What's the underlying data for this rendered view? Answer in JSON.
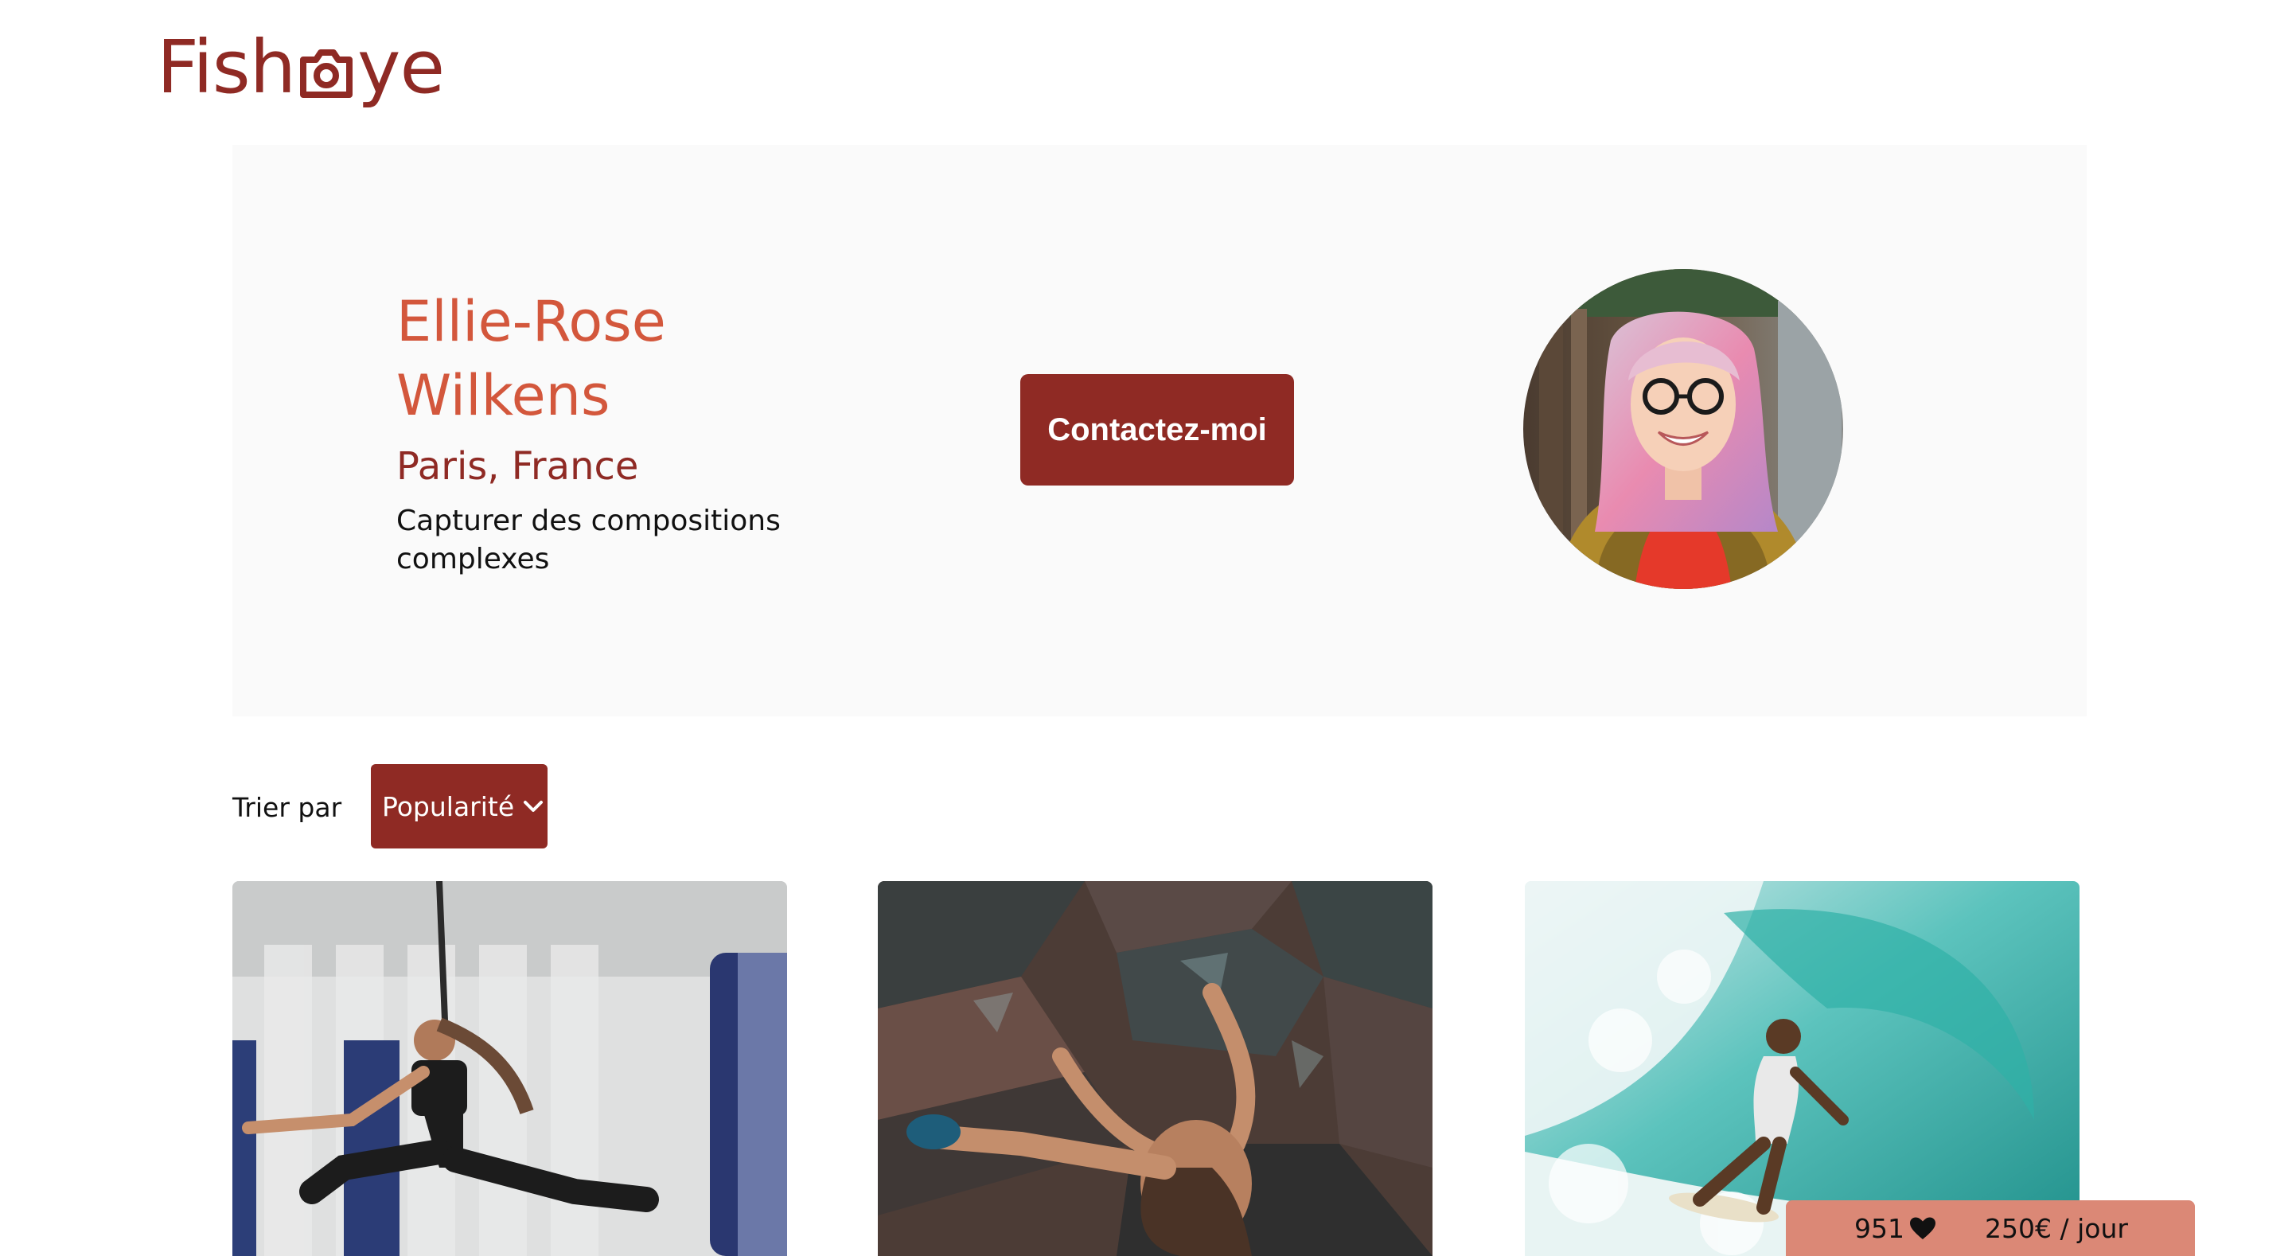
{
  "logo": {
    "text_left": "Fish",
    "text_right": "ye",
    "icon": "camera-icon",
    "color": "#8f2a24"
  },
  "photographer": {
    "name": "Ellie-Rose Wilkens",
    "location": "Paris, France",
    "tagline": "Capturer des compositions complexes",
    "contact_label": "Contactez-moi",
    "avatar_alt": "Ellie-Rose Wilkens"
  },
  "sort": {
    "label": "Trier par",
    "selected": "Popularité",
    "icon": "chevron-down-icon"
  },
  "media": [
    {
      "alt": "sport-gymnast-photo"
    },
    {
      "alt": "rock-climbing-photo"
    },
    {
      "alt": "surfing-wave-photo"
    }
  ],
  "stats": {
    "likes": "951",
    "like_icon": "heart-icon",
    "price": "250€ / jour"
  },
  "colors": {
    "primary": "#8f2a24",
    "secondary": "#d3573c",
    "stats_bg": "#db8876",
    "banner_bg": "#fafafa"
  }
}
